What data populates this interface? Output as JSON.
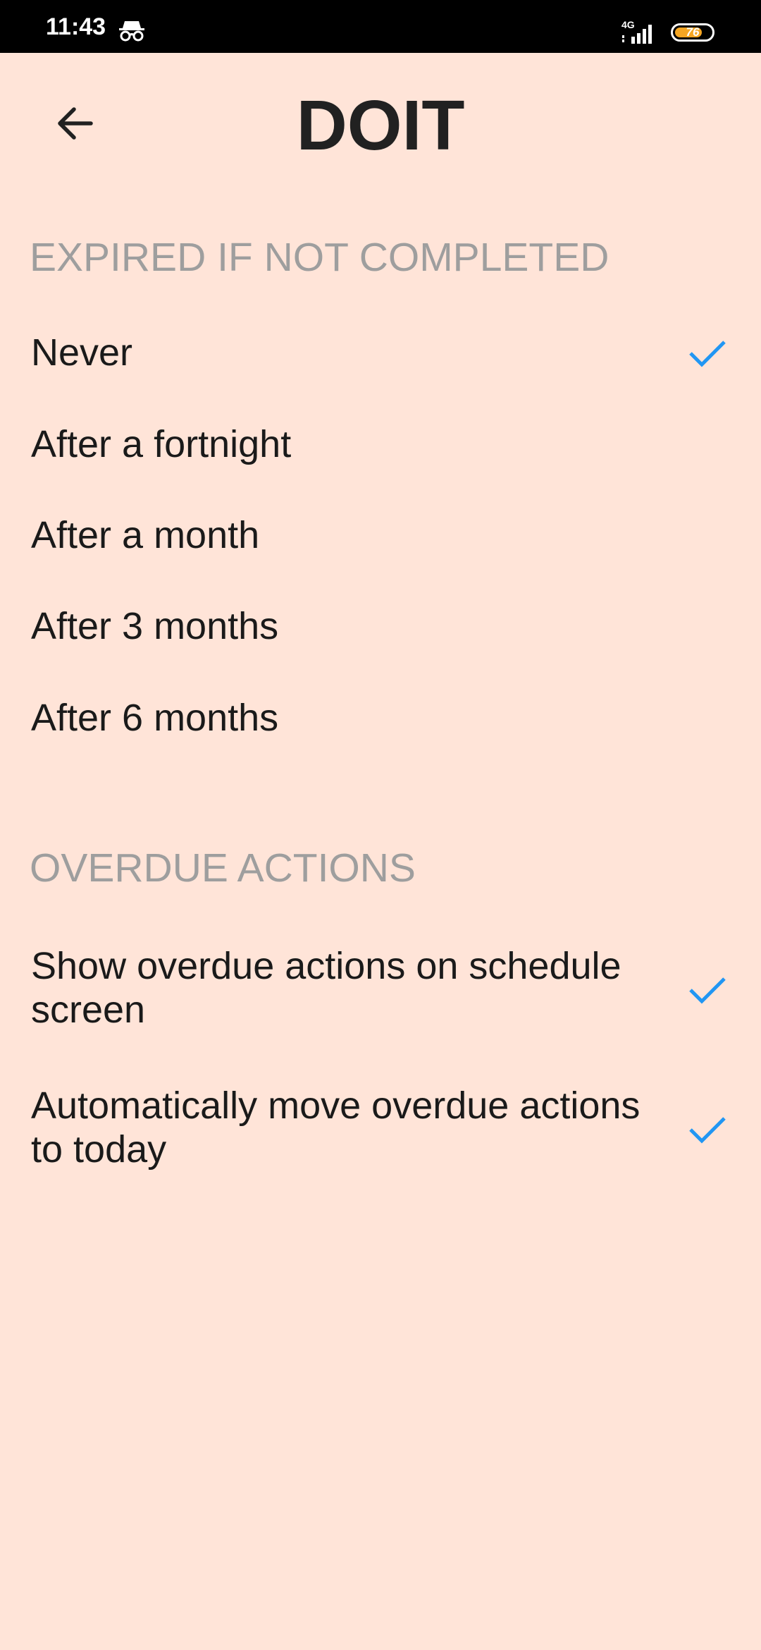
{
  "status_bar": {
    "time": "11:43",
    "network": "4G",
    "battery_level": "76",
    "battery_color": "#f5a623"
  },
  "app_bar": {
    "back_icon": "arrow-left-icon",
    "title": "DOIT"
  },
  "sections": {
    "expired": {
      "header": "EXPIRED IF NOT COMPLETED",
      "options": [
        {
          "label": "Never",
          "checked": true
        },
        {
          "label": "After a fortnight",
          "checked": false
        },
        {
          "label": "After a month",
          "checked": false
        },
        {
          "label": "After 3 months",
          "checked": false
        },
        {
          "label": "After 6 months",
          "checked": false
        }
      ]
    },
    "overdue": {
      "header": "OVERDUE ACTIONS",
      "options": [
        {
          "label": "Show overdue actions on schedule screen",
          "checked": true
        },
        {
          "label": "Automatically move overdue actions to today",
          "checked": true
        }
      ]
    }
  },
  "colors": {
    "background": "#ffe4d8",
    "accent": "#2196f3",
    "section_header": "#9e9e9e"
  }
}
